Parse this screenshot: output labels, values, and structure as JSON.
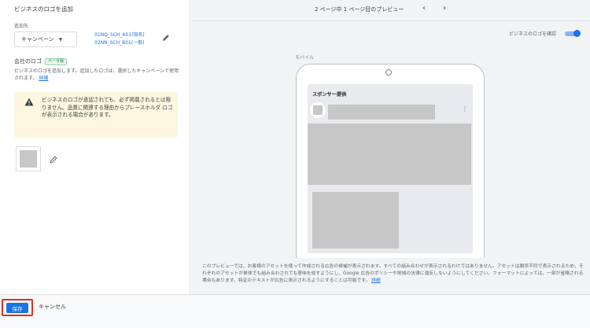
{
  "left": {
    "title": "ビジネスのロゴを追加",
    "destination_label": "追加先",
    "campaign_select": "キャンペーン",
    "campaign_links": [
      "01NQ_SCH_A01(指名)",
      "02NN_SCH_B01(一般)"
    ],
    "company_logo_label": "会社のロゴ",
    "beta_badge": "ベータ版",
    "description": "ビジネスのロゴを追加します。追加したロゴは、選択したキャンペーンで使用されます。",
    "description_link": "詳細",
    "warning": "ビジネスのロゴが承認されても、必ず掲載されるとは限りません。品質に関連する理由からプレースホルダ ロゴが表示される場合があります。"
  },
  "right": {
    "preview_nav": "2 ページ中 1 ページ目のプレビュー",
    "nav_prev": "‹",
    "nav_next": "›",
    "confirm_logo_label": "ビジネスのロゴを確認",
    "mobile_label": "モバイル",
    "sponsor_label": "スポンサー提供",
    "footnote": "このプレビューでは、お客様のアセットを使って作成される広告の候補が表示されます。すべての組み合わせが表示されるわけではありません。アセットは順序不同で表示されるため、それぞれのアセットが単体でも組み合わされても意味を成すようにし、Google 広告のポリシーや地域の法律に違反しないようにしてください。フォーマットによっては、一部が省略される場合もあります。特定のテキストが広告に表示されるようにすることは可能です。",
    "footnote_link": "詳細"
  },
  "bottom": {
    "save_label": "保存",
    "cancel_label": "キャンセル"
  },
  "colors": {
    "accent": "#1a73e8",
    "warning_bg": "#fef7e0",
    "highlight": "#d93025"
  }
}
